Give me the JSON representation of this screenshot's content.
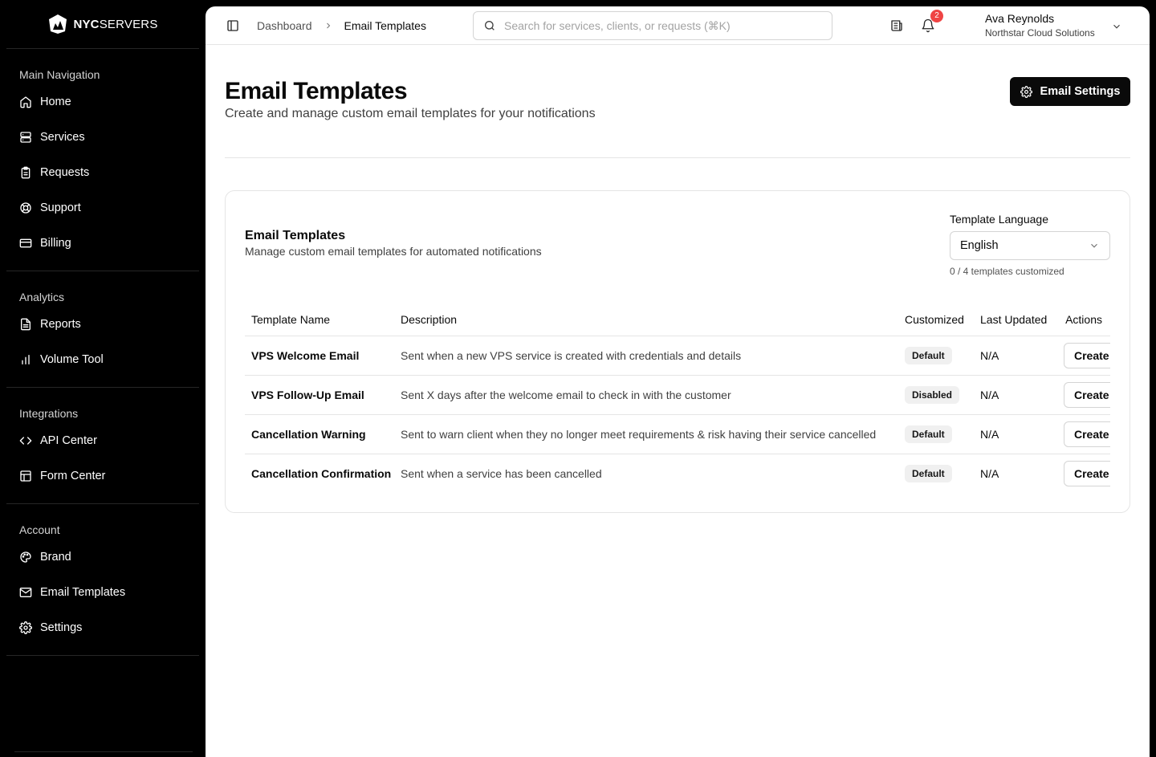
{
  "brand": {
    "logo_bold": "NYC",
    "logo_light": "SERVERS"
  },
  "sidebar": {
    "sections": [
      {
        "heading": "Main Navigation",
        "items": [
          {
            "label": "Home",
            "icon": "home-icon"
          },
          {
            "label": "Services",
            "icon": "server-icon"
          },
          {
            "label": "Requests",
            "icon": "clipboard-icon"
          },
          {
            "label": "Support",
            "icon": "lifebuoy-icon"
          },
          {
            "label": "Billing",
            "icon": "credit-card-icon"
          }
        ]
      },
      {
        "heading": "Analytics",
        "items": [
          {
            "label": "Reports",
            "icon": "file-text-icon"
          },
          {
            "label": "Volume Tool",
            "icon": "bar-chart-icon"
          }
        ]
      },
      {
        "heading": "Integrations",
        "items": [
          {
            "label": "API Center",
            "icon": "code-icon"
          },
          {
            "label": "Form Center",
            "icon": "layout-icon"
          }
        ]
      },
      {
        "heading": "Account",
        "items": [
          {
            "label": "Brand",
            "icon": "palette-icon"
          },
          {
            "label": "Email Templates",
            "icon": "mail-icon"
          },
          {
            "label": "Settings",
            "icon": "gear-icon"
          }
        ]
      }
    ]
  },
  "header": {
    "breadcrumb": [
      "Dashboard",
      "Email Templates"
    ],
    "search_placeholder": "Search for services, clients, or requests (⌘K)",
    "notification_count": "2",
    "user_name": "Ava Reynolds",
    "user_org": "Northstar Cloud Solutions"
  },
  "page": {
    "title": "Email Templates",
    "subtitle": "Create and manage custom email templates for your notifications",
    "settings_button": "Email Settings"
  },
  "card": {
    "title": "Email Templates",
    "subtitle": "Manage custom email templates for automated notifications",
    "language_label": "Template Language",
    "language_value": "English",
    "customized_count": "0 / 4 templates customized"
  },
  "table": {
    "columns": [
      "Template Name",
      "Description",
      "Customized",
      "Last Updated",
      "Actions"
    ],
    "rows": [
      {
        "name": "VPS Welcome Email",
        "description": "Sent when a new VPS service is created with credentials and details",
        "status": "Default",
        "updated": "N/A",
        "action": "Create"
      },
      {
        "name": "VPS Follow-Up Email",
        "description": "Sent X days after the welcome email to check in with the customer",
        "status": "Disabled",
        "updated": "N/A",
        "action": "Create"
      },
      {
        "name": "Cancellation Warning",
        "description": "Sent to warn client when they no longer meet requirements & risk having their service cancelled",
        "status": "Default",
        "updated": "N/A",
        "action": "Create"
      },
      {
        "name": "Cancellation Confirmation",
        "description": "Sent when a service has been cancelled",
        "status": "Default",
        "updated": "N/A",
        "action": "Create"
      }
    ]
  }
}
